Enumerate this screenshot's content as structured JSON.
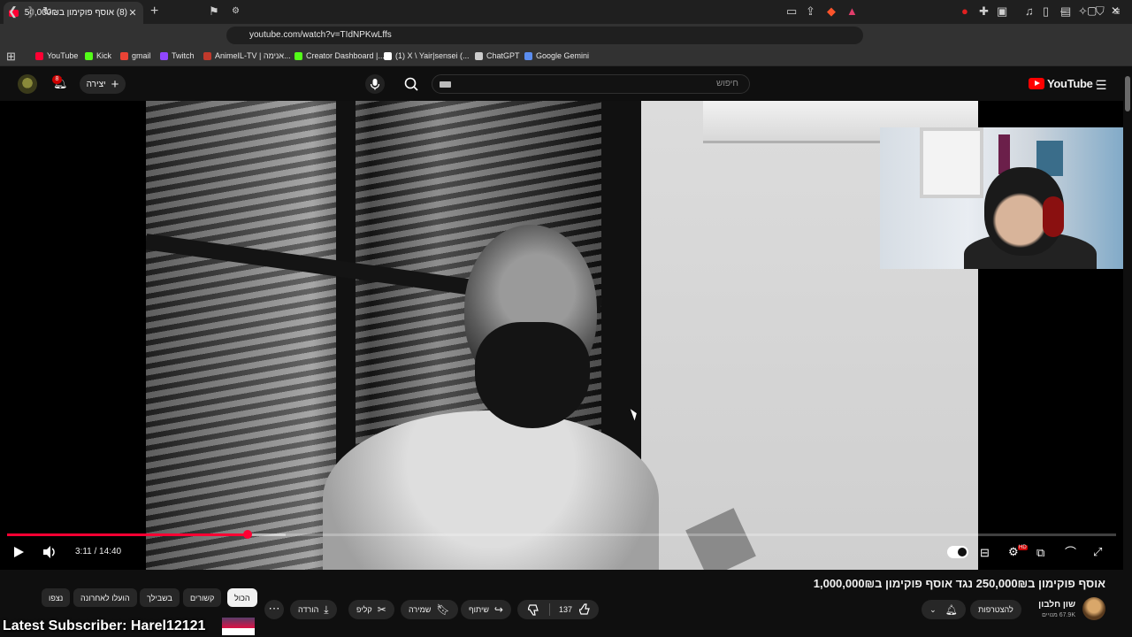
{
  "browser": {
    "tab": {
      "title": "(8) אוסף פוקימון ב250,000₪ נגד",
      "close": "✕"
    },
    "new_tab": "+",
    "window_controls": {
      "minimize": "–",
      "maximize": "▢",
      "close": "✕"
    },
    "url": "youtube.com/watch?v=TIdNPKwLffs",
    "bookmarks": [
      {
        "label": "YouTube",
        "icon": "youtube-icon",
        "color": "#ff0033"
      },
      {
        "label": "Kick",
        "icon": "kick-icon",
        "color": "#53fc18"
      },
      {
        "label": "gmail",
        "icon": "gmail-icon",
        "color": "#ea4335"
      },
      {
        "label": "Twitch",
        "icon": "twitch-icon",
        "color": "#9146ff"
      },
      {
        "label": "AnimeIL-TV | אנימה...",
        "icon": "animeil-icon",
        "color": "#c0392b"
      },
      {
        "label": "Creator Dashboard |...",
        "icon": "kick-icon",
        "color": "#53fc18"
      },
      {
        "label": "(1) X \\ Yair|sensei (...",
        "icon": "x-icon",
        "color": "#ffffff"
      },
      {
        "label": "ChatGPT",
        "icon": "chatgpt-icon",
        "color": "#cccccc"
      },
      {
        "label": "Google Gemini",
        "icon": "gemini-icon",
        "color": "#5b8def"
      }
    ]
  },
  "header": {
    "create_label": "יצירה",
    "notification_count": "8",
    "search_placeholder": "חיפוש",
    "logo_text": "YouTube",
    "logo_sup": "IL"
  },
  "player": {
    "time_current": "3:11",
    "time_total": "14:40",
    "time_display": "3:11 / 14:40",
    "progress_fraction": 0.2171,
    "buffered_fraction": 0.2515,
    "hd_badge": "HD",
    "accent_color": "#ff0033"
  },
  "video": {
    "title": "אוסף פוקימון ב250,000₪ נגד אוסף פוקימון ב1,000,000₪",
    "channel_name": "שון חלבון",
    "channel_subs": "67.9K מנויים",
    "subscribe_label": "להצטרפות",
    "like_count": "137",
    "actions": {
      "share": "שיתוף",
      "save": "שמירה",
      "clip": "קליפ",
      "download": "הורדה"
    }
  },
  "chips": [
    "הכול",
    "קשורים",
    "בשבילך",
    "הועלו לאחרונה",
    "נצפו"
  ],
  "stream_overlay": {
    "text": "Latest Subscriber: Harel12121"
  }
}
